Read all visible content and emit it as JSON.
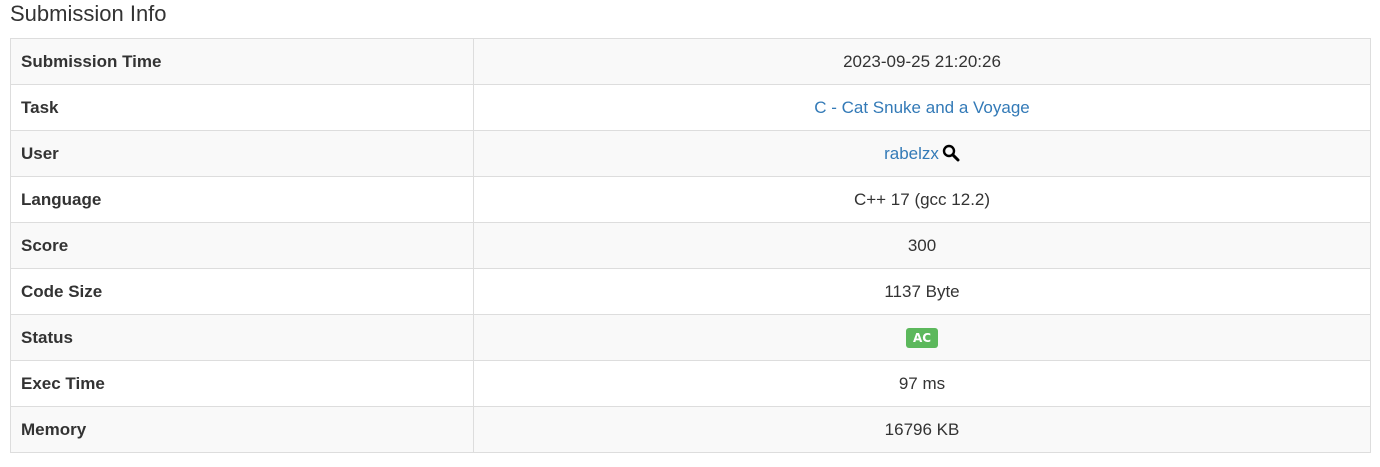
{
  "title": "Submission Info",
  "rows": [
    {
      "label": "Submission Time",
      "value": "2023-09-25 21:20:26"
    },
    {
      "label": "Task",
      "value": "C - Cat Snuke and a Voyage"
    },
    {
      "label": "User",
      "value": "rabelzx",
      "icon": "search-icon"
    },
    {
      "label": "Language",
      "value": "C++ 17 (gcc 12.2)"
    },
    {
      "label": "Score",
      "value": "300"
    },
    {
      "label": "Code Size",
      "value": "1137 Byte"
    },
    {
      "label": "Status",
      "value": "AC",
      "badge_color": "#5cb85c"
    },
    {
      "label": "Exec Time",
      "value": "97 ms"
    },
    {
      "label": "Memory",
      "value": "16796 KB"
    }
  ],
  "colors": {
    "link": "#337ab7",
    "accepted": "#5cb85c",
    "border": "#dddddd",
    "row_stripe": "#f9f9f9"
  }
}
